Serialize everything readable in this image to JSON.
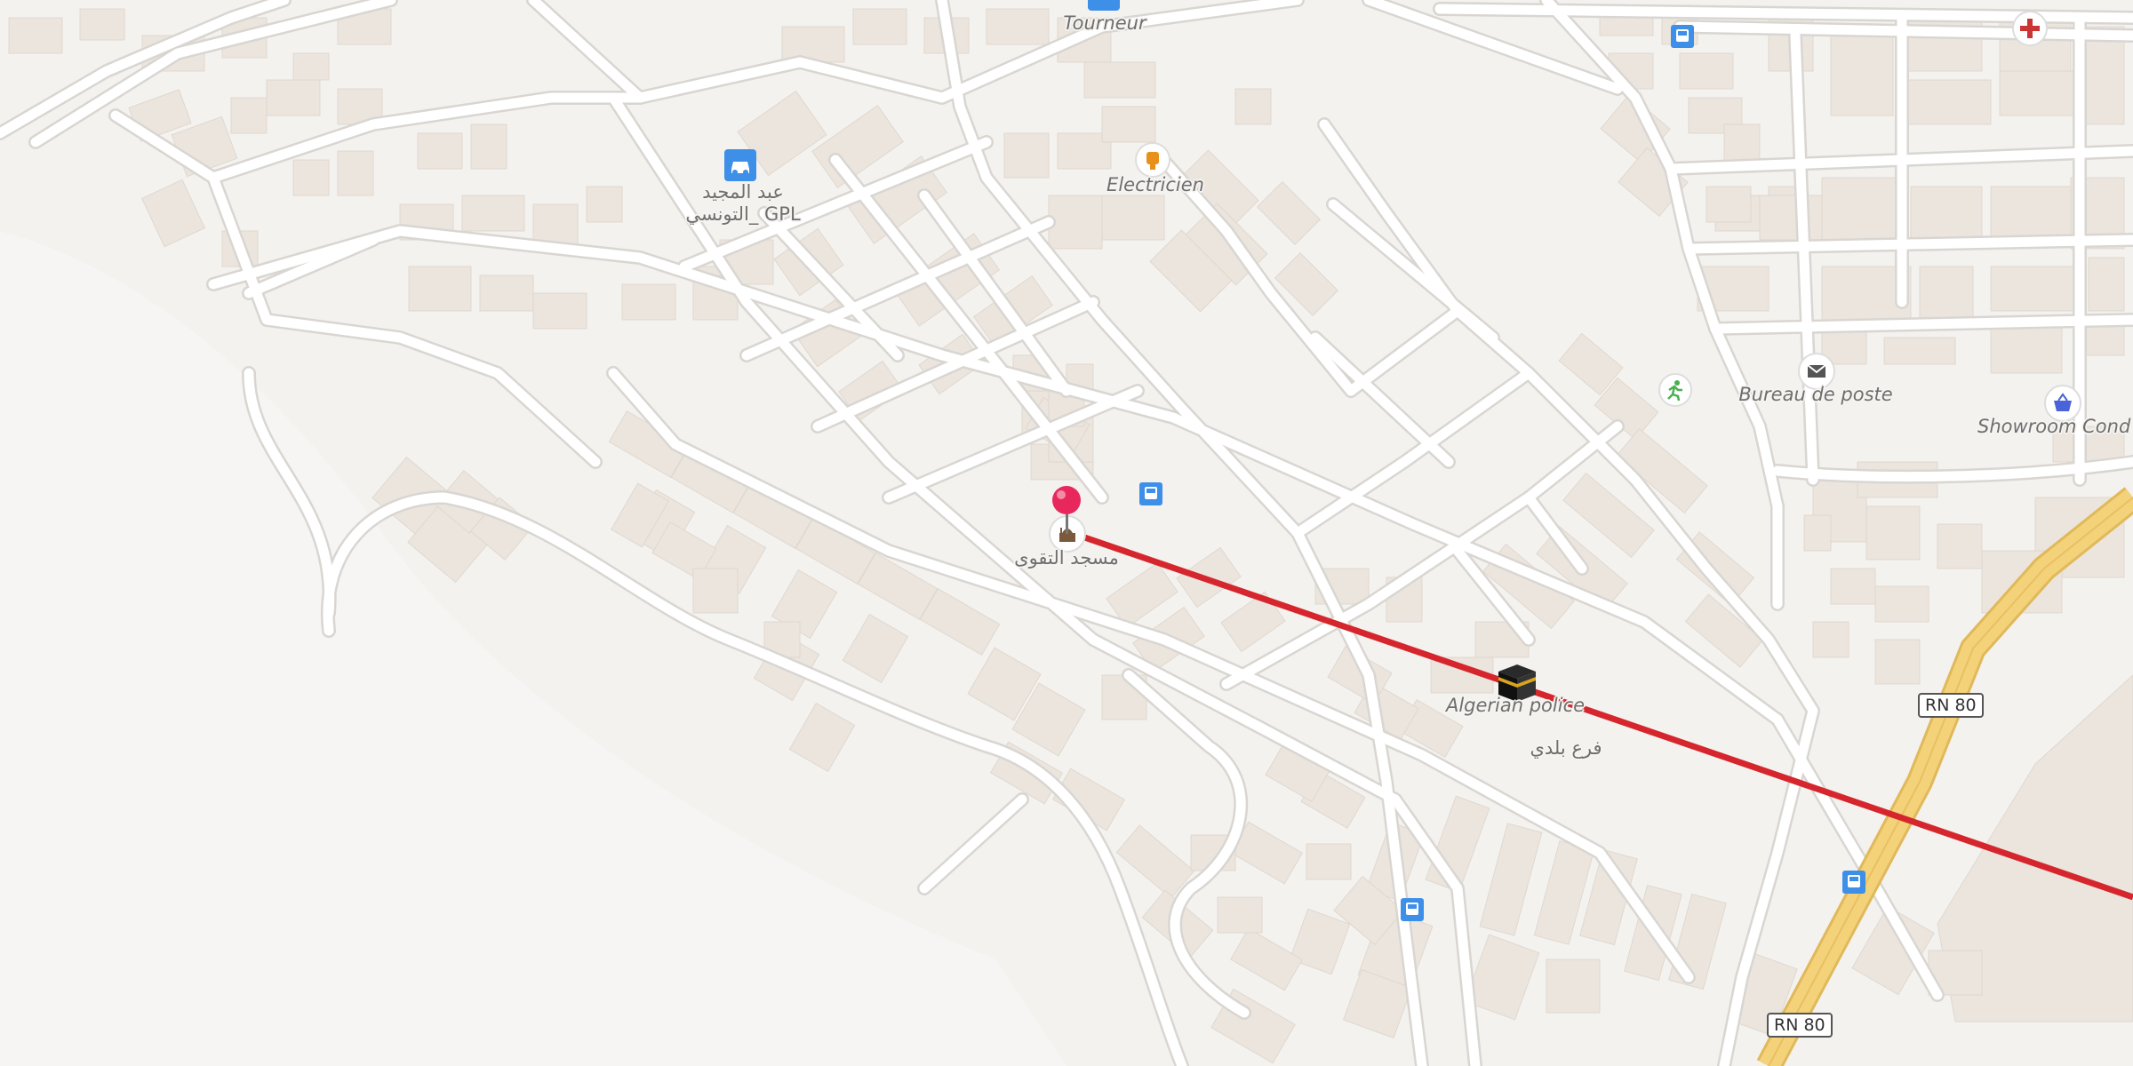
{
  "map": {
    "colors": {
      "background": "#f4f2ef",
      "road": "#ffffff",
      "road_casing": "#d9d6d2",
      "building": "#ebe5de",
      "major_road": "#f4d27a",
      "route_line": "#d6262d",
      "pin": "#e8285c"
    },
    "labels": {
      "tourneur": "Tourneur",
      "electricien": "Electricien",
      "gpl_line1": "عبد المجيد",
      "gpl_line2": "التونسي_ GPL",
      "mosque": "مسجد التقوى",
      "algerian_police": "Algerian police",
      "farh_baladi": "فرع بلدي",
      "bureau_de_poste": "Bureau de poste",
      "showroom": "Showroom Cond"
    },
    "road_shields": {
      "rn80_upper": "RN 80",
      "rn80_lower": "RN 80"
    },
    "icons": {
      "car": "car-icon",
      "bus": "bus-stop-icon",
      "electrician": "electrician-icon",
      "hospital": "hospital-cross-icon",
      "sport": "running-figure-icon",
      "post": "envelope-icon",
      "shop": "shopping-basket-icon",
      "mosque": "mosque-icon",
      "kaaba": "kaaba-icon",
      "pin": "location-pin-icon"
    }
  }
}
